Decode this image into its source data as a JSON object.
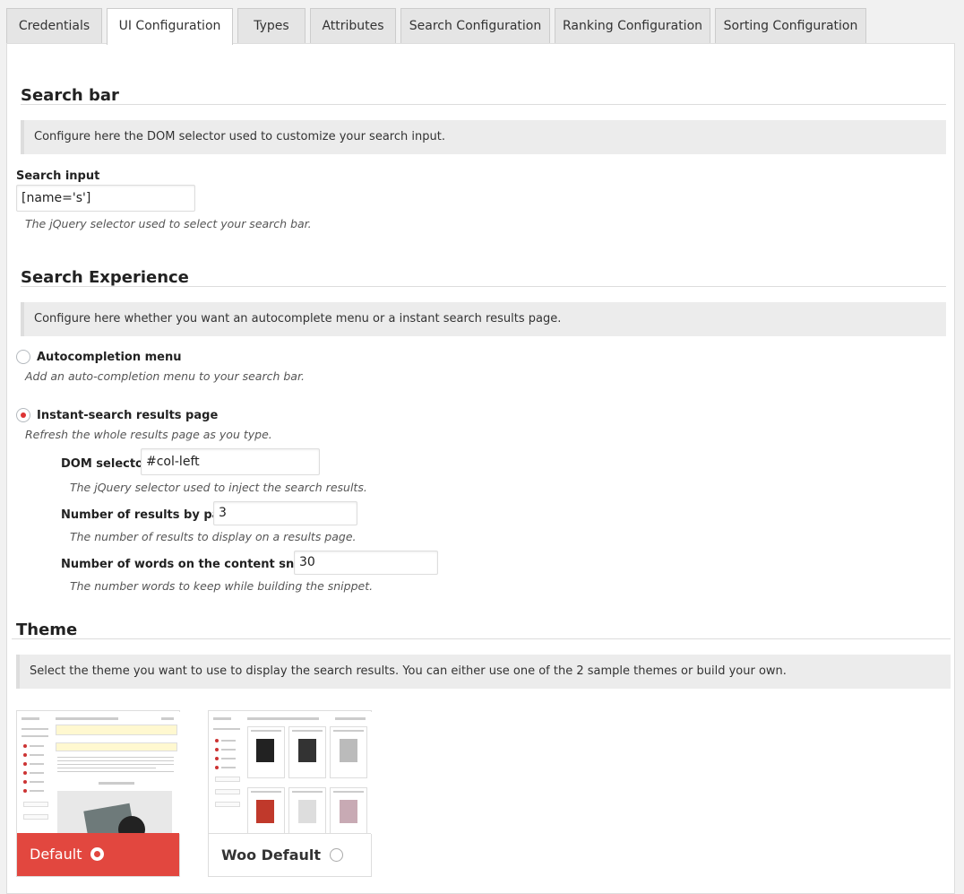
{
  "tabs": [
    {
      "label": "Credentials",
      "active": false
    },
    {
      "label": "UI Configuration",
      "active": true
    },
    {
      "label": "Types",
      "active": false
    },
    {
      "label": "Attributes",
      "active": false
    },
    {
      "label": "Search Configuration",
      "active": false
    },
    {
      "label": "Ranking Configuration",
      "active": false
    },
    {
      "label": "Sorting Configuration",
      "active": false
    }
  ],
  "search_bar": {
    "title": "Search bar",
    "notice": "Configure here the DOM selector used to customize your search input.",
    "input_label": "Search input",
    "input_value": "[name='s']",
    "input_desc": "The jQuery selector used to select your search bar."
  },
  "search_experience": {
    "title": "Search Experience",
    "notice": "Configure here whether you want an autocomplete menu or a instant search results page.",
    "autocomplete": {
      "label": "Autocompletion menu",
      "desc": "Add an auto-completion menu to your search bar.",
      "checked": false
    },
    "instant": {
      "label": "Instant-search results page",
      "desc": "Refresh the whole results page as you type.",
      "checked": true,
      "dom_selector_label": "DOM selector",
      "dom_selector_value": "#col-left",
      "dom_selector_desc": "The jQuery selector used to inject the search results.",
      "results_label": "Number of results by page",
      "results_value": "3",
      "results_desc": "The number of results to display on a results page.",
      "words_label": "Number of words on the content snippet",
      "words_value": "30",
      "words_desc": "The number words to keep while building the snippet."
    }
  },
  "theme": {
    "title": "Theme",
    "notice": "Select the theme you want to use to display the search results. You can either use one of the 2 sample themes or build your own.",
    "options": [
      {
        "label": "Default",
        "selected": true
      },
      {
        "label": "Woo Default",
        "selected": false
      }
    ]
  },
  "colors": {
    "accent": "#e2473f",
    "radio_checked": "#dd3333"
  }
}
